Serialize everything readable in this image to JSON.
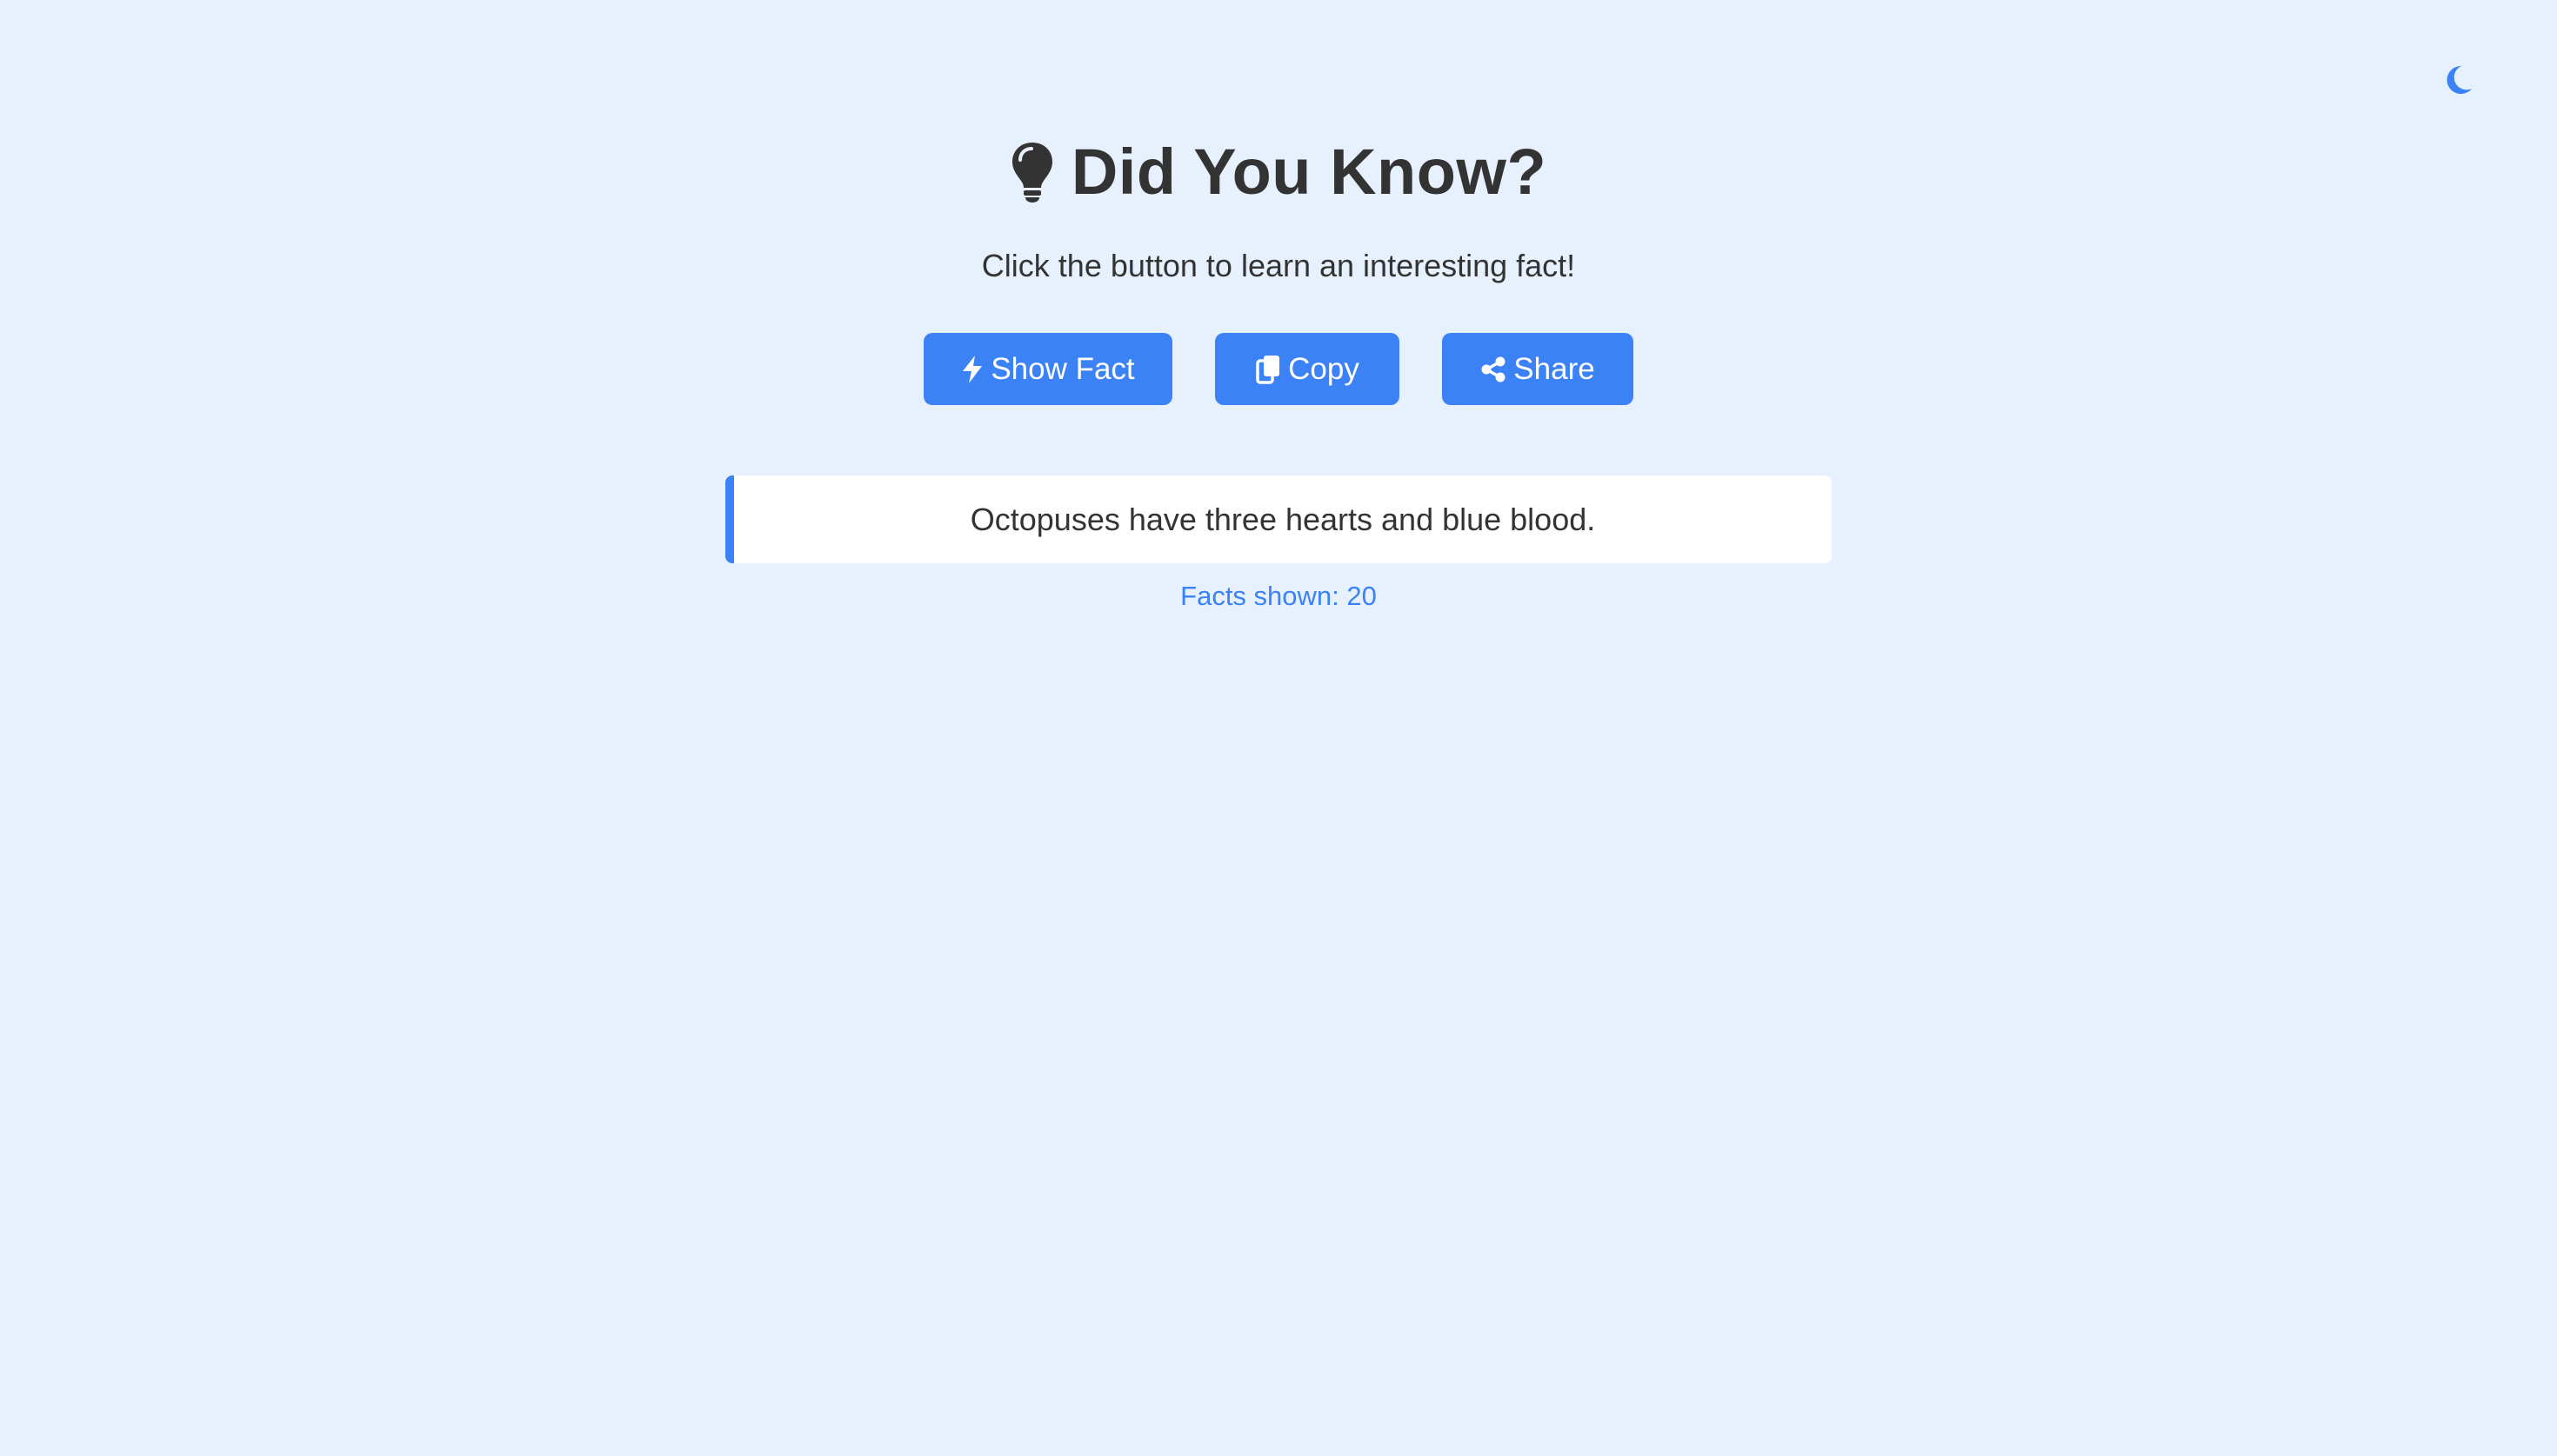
{
  "theme_toggle": {
    "icon": "moon-icon",
    "color": "#3b82f6"
  },
  "header": {
    "icon": "lightbulb-icon",
    "title": "Did You Know?"
  },
  "subtitle": "Click the button to learn an interesting fact!",
  "buttons": {
    "show_fact": {
      "icon": "bolt-icon",
      "label": "Show Fact"
    },
    "copy": {
      "icon": "copy-icon",
      "label": "Copy"
    },
    "share": {
      "icon": "share-icon",
      "label": "Share"
    }
  },
  "fact": {
    "text": "Octopuses have three hearts and blue blood."
  },
  "counter": {
    "text": "Facts shown: 20"
  },
  "colors": {
    "background": "#e7f1fd",
    "accent": "#3b82f6",
    "text": "#333333",
    "card": "#ffffff"
  }
}
